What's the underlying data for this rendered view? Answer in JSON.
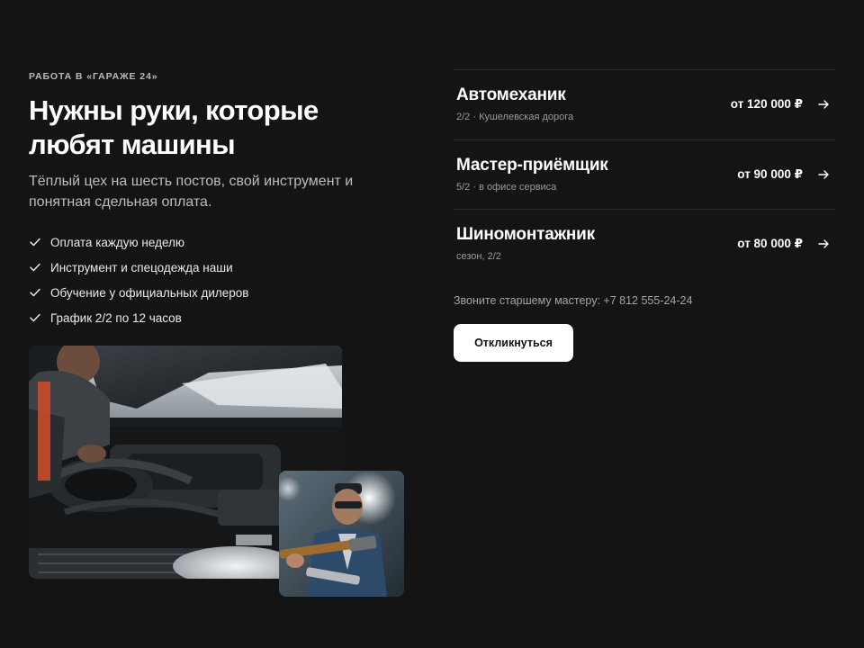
{
  "intro": {
    "eyebrow": "РАБОТА В «ГАРАЖЕ 24»",
    "title": "Нужны руки, которые любят машины",
    "lead": "Тёплый цех на шесть постов, свой инструмент и понятная сдельная оплата."
  },
  "benefits": [
    "Оплата каждую неделю",
    "Инструмент и спецодежда наши",
    "Обучение у официальных дилеров",
    "График 2/2 по 12 часов"
  ],
  "jobs": [
    {
      "title": "Автомеханик",
      "meta": "2/2 · Кушелевская дорога",
      "salary": "от 120 000 ₽"
    },
    {
      "title": "Мастер-приёмщик",
      "meta": "5/2 · в офисе сервиса",
      "salary": "от 90 000 ₽"
    },
    {
      "title": "Шиномонтажник",
      "meta": "сезон, 2/2",
      "salary": "от 80 000 ₽"
    }
  ],
  "contact": "Звоните старшему мастеру: +7 812 555-24-24",
  "apply_label": "Откликнуться",
  "icons": {
    "benefit": "check-icon",
    "job": "arrow-right-icon"
  },
  "images": {
    "main": "mechanic-engine-bay-photo",
    "small": "mechanic-with-tool-photo"
  },
  "colors": {
    "background": "#141414",
    "text": "#ffffff",
    "muted": "#9a9a9a",
    "divider": "#2c2c2c",
    "button_bg": "#ffffff",
    "button_text": "#111111"
  }
}
